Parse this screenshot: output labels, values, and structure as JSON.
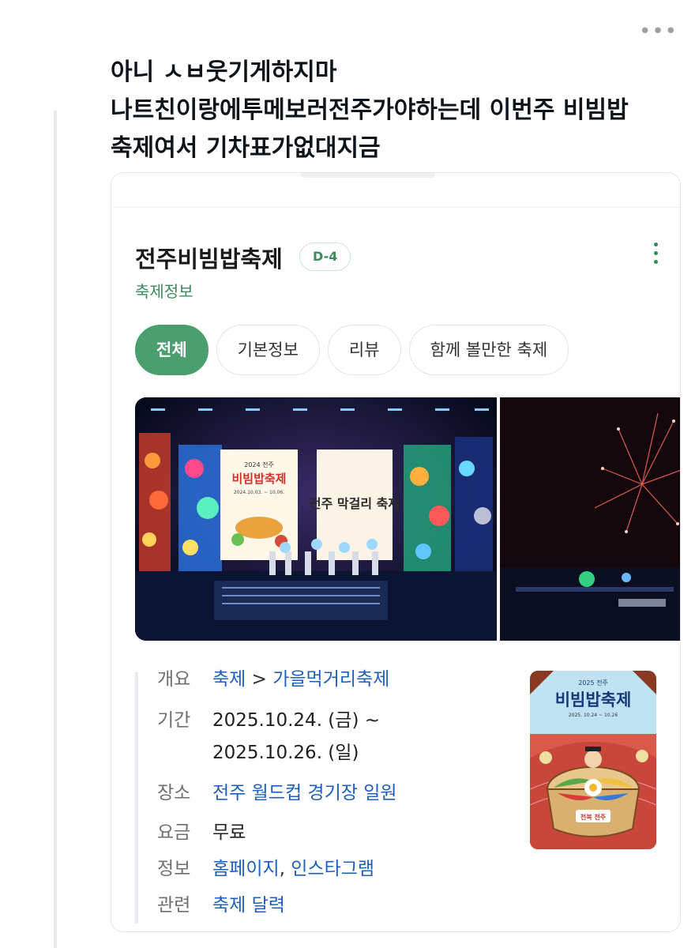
{
  "post": {
    "lines": [
      "아니 ㅅㅂ웃기게하지마",
      "나트친이랑에투메보러전주가야하는데 이번주 비빔밥",
      "축제여서 기차표가없대지금"
    ]
  },
  "card": {
    "title": "전주비빔밥축제",
    "dday": "D-4",
    "subtitle": "축제정보",
    "tabs": [
      {
        "label": "전체",
        "active": true
      },
      {
        "label": "기본정보",
        "active": false
      },
      {
        "label": "리뷰",
        "active": false
      },
      {
        "label": "함께 볼만한 축제",
        "active": false
      }
    ],
    "poster_on_stage_1": {
      "year_line": "2024 전주",
      "title": "비빔밥축제",
      "dates": "2024.10.03. ~ 10.06."
    },
    "poster_on_stage_2": {
      "title": "전주 막걸리 축제"
    },
    "info": {
      "overview_label": "개요",
      "overview_link1": "축제",
      "overview_sep": " > ",
      "overview_link2": "가을먹거리축제",
      "period_label": "기간",
      "period_line1": "2025.10.24. (금) ~",
      "period_line2": "2025.10.26. (일)",
      "place_label": "장소",
      "place_value": "전주 월드컵 경기장 일원",
      "fee_label": "요금",
      "fee_value": "무료",
      "more_label": "정보",
      "more_link1": "홈페이지",
      "more_sep": ", ",
      "more_link2": "인스타그램",
      "related_label": "관련",
      "related_value": "축제 달력"
    },
    "poster": {
      "year_line": "2025 전주",
      "title": "비빔밥축제",
      "dates": "2025. 10.24 ~ 10.26",
      "badge": "전북 전주"
    },
    "colors": {
      "green": "#4b9e6e",
      "link": "#1c5fbf"
    }
  }
}
